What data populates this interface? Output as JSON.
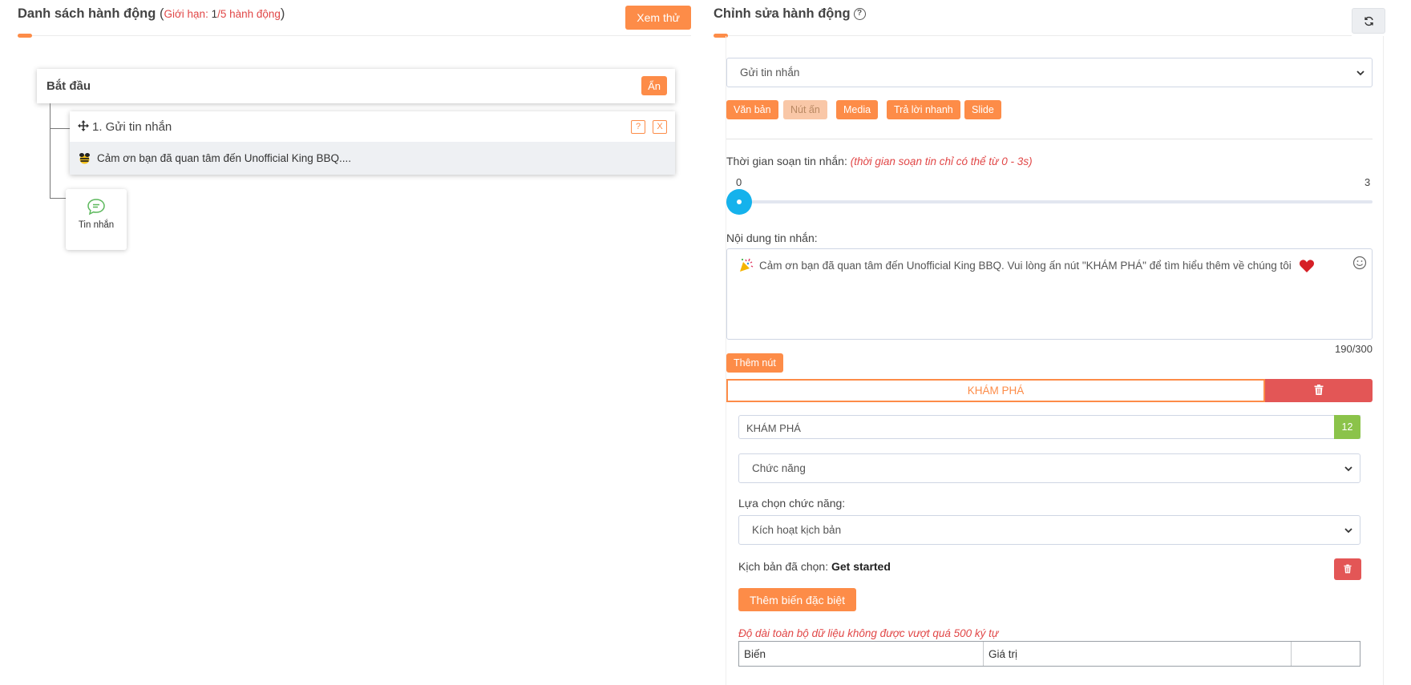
{
  "left": {
    "title": "Danh sách hành động",
    "limit_label": "Giới hạn: ",
    "limit_current": "1",
    "limit_rest": "/5 hành động",
    "preview_button": "Xem thử",
    "start_card": {
      "title": "Bắt đầu",
      "hide_button": "Ẩn"
    },
    "action_card": {
      "title": "1. Gửi tin nhắn",
      "help_button": "?",
      "close_button": "X",
      "preview_text": "Cảm ơn bạn đã quan tâm đến Unofficial King BBQ...."
    },
    "message_node_label": "Tin nhắn"
  },
  "right": {
    "title": "Chỉnh sửa hành động",
    "help_symbol": "?",
    "action_type": "Gửi tin nhắn",
    "tabs": [
      {
        "label": "Văn bản"
      },
      {
        "label": "Nút ấn"
      },
      {
        "label": "Media"
      },
      {
        "label": "Trả lời nhanh"
      },
      {
        "label": "Slide"
      }
    ],
    "typing_time": {
      "label": "Thời gian soạn tin nhắn: ",
      "note": "(thời gian soạn tin chỉ có thể từ 0 - 3s)",
      "min": "0",
      "max": "3",
      "value": 0
    },
    "content": {
      "label": "Nội dung tin nhắn:",
      "text": "Cảm ơn bạn đã quan tâm đến Unofficial King BBQ. Vui lòng ấn nút \"KHÁM PHÁ\" để tìm hiểu thêm về chúng tôi",
      "char_count": "190/300"
    },
    "add_button": "Thêm nút",
    "button_item": {
      "name": "KHÁM PHÁ",
      "input_value": "KHÁM PHÁ",
      "remaining": "12"
    },
    "function_select": "Chức năng",
    "function_choice_label": "Lựa chọn chức năng:",
    "function_choice_value": "Kích hoạt kịch bản",
    "selected_script_label": "Kịch bản đã chọn: ",
    "selected_script_value": "Get started",
    "special_var_button": "Thêm biến đặc biệt",
    "length_warning": "Độ dài toàn bộ dữ liệu không được vượt quá 500 ký tự",
    "table_headers": [
      "Biến",
      "Giá trị"
    ]
  },
  "colors": {
    "accent": "#fd8c48",
    "danger": "#e35656",
    "slider": "#15b2ec",
    "counter": "#8bc34a",
    "note": "#e14747"
  }
}
